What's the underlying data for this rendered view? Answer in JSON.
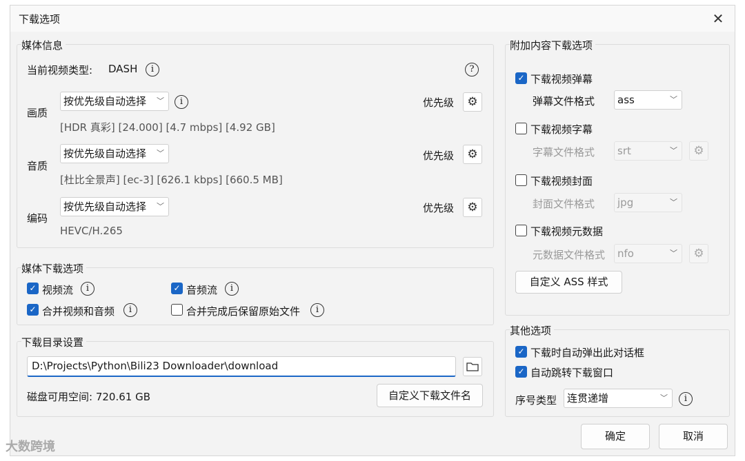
{
  "window": {
    "title": "下载选项",
    "close_glyph": "✕"
  },
  "media_info": {
    "title": "媒体信息",
    "video_type_label": "当前视频类型:",
    "video_type_value": "DASH",
    "help_glyph": "?",
    "info_glyph": "i",
    "gear_glyph": "⚙",
    "priority_label": "优先级",
    "quality": {
      "label": "画质",
      "selected": "按优先级自动选择",
      "details": "[HDR 真彩]  [24.000]  [4.7 mbps]  [4.92 GB]"
    },
    "audio": {
      "label": "音质",
      "selected": "按优先级自动选择",
      "details": "[杜比全景声]  [ec-3]  [626.1 kbps]  [660.5 MB]"
    },
    "codec": {
      "label": "编码",
      "selected": "按优先级自动选择",
      "details": "HEVC/H.265"
    },
    "chevron": "﹀"
  },
  "media_download": {
    "title": "媒体下载选项",
    "video_stream": {
      "label": "视频流",
      "checked": true
    },
    "audio_stream": {
      "label": "音频流",
      "checked": true
    },
    "merge": {
      "label": "合并视频和音频",
      "checked": true
    },
    "keep_original": {
      "label": "合并完成后保留原始文件",
      "checked": false
    },
    "check_glyph": "✓"
  },
  "directory": {
    "title": "下载目录设置",
    "path": "D:\\Projects\\Python\\Bili23 Downloader\\download",
    "disk_space": "磁盘可用空间: 720.61 GB",
    "custom_filename_button": "自定义下载文件名"
  },
  "extras": {
    "title": "附加内容下载选项",
    "danmaku": {
      "label": "下载视频弹幕",
      "checked": true,
      "format_label": "弹幕文件格式",
      "format": "ass"
    },
    "subtitle": {
      "label": "下载视频字幕",
      "checked": false,
      "format_label": "字幕文件格式",
      "format": "srt"
    },
    "cover": {
      "label": "下载视频封面",
      "checked": false,
      "format_label": "封面文件格式",
      "format": "jpg"
    },
    "metadata": {
      "label": "下载视频元数据",
      "checked": false,
      "format_label": "元数据文件格式",
      "format": "nfo"
    },
    "custom_ass_button": "自定义 ASS 样式"
  },
  "other": {
    "title": "其他选项",
    "auto_popup": {
      "label": "下载时自动弹出此对话框",
      "checked": true
    },
    "auto_jump": {
      "label": "自动跳转下载窗口",
      "checked": true
    },
    "seq_label": "序号类型",
    "seq_value": "连贯递增"
  },
  "footer": {
    "ok": "确定",
    "cancel": "取消"
  },
  "watermark": "大数跨境"
}
